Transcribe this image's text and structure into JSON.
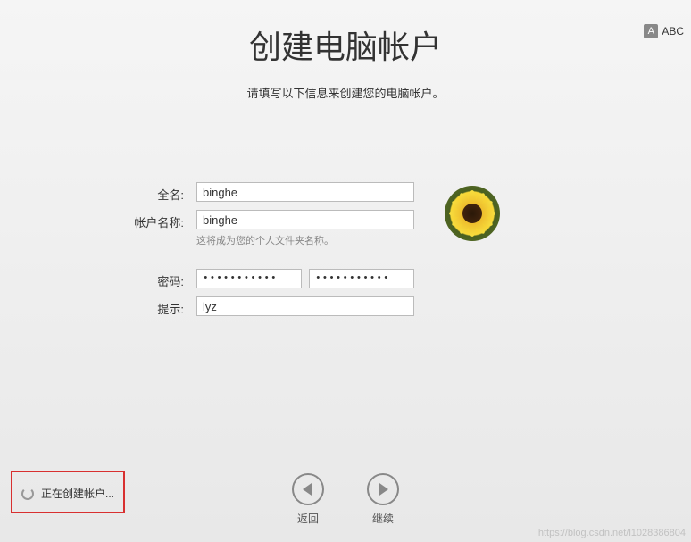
{
  "input_method": {
    "badge": "A",
    "label": "ABC"
  },
  "header": {
    "title": "创建电脑帐户",
    "subtitle": "请填写以下信息来创建您的电脑帐户。"
  },
  "form": {
    "full_name": {
      "label": "全名:",
      "value": "binghe"
    },
    "account_name": {
      "label": "帐户名称:",
      "value": "binghe",
      "hint": "这将成为您的个人文件夹名称。"
    },
    "password": {
      "label": "密码:",
      "value_masked": "•••••••••••",
      "confirm_masked": "•••••••••••"
    },
    "hint": {
      "label": "提示:",
      "value": "lyz"
    }
  },
  "avatar": {
    "name": "sunflower"
  },
  "status": {
    "text": "正在创建帐户..."
  },
  "nav": {
    "back": "返回",
    "continue": "继续"
  },
  "watermark": "https://blog.csdn.net/l1028386804"
}
